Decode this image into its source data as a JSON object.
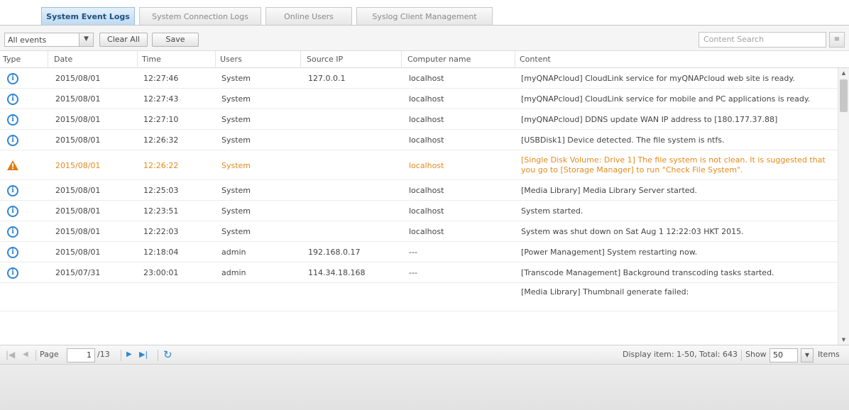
{
  "tabs": [
    {
      "label": "System Event Logs",
      "active": true
    },
    {
      "label": "System Connection Logs",
      "active": false
    },
    {
      "label": "Online Users",
      "active": false
    },
    {
      "label": "Syslog Client Management",
      "active": false
    }
  ],
  "toolbar": {
    "filter_value": "All events",
    "clear_all_label": "Clear All",
    "save_label": "Save",
    "search_placeholder": "Content Search"
  },
  "columns": [
    "Type",
    "Date",
    "Time",
    "Users",
    "Source IP",
    "Computer name",
    "Content"
  ],
  "rows": [
    {
      "type": "info",
      "date": "2015/08/01",
      "time": "12:27:46",
      "user": "System",
      "ip": "127.0.0.1",
      "computer": "localhost",
      "content": "[myQNAPcloud] CloudLink service for myQNAPcloud web site is ready."
    },
    {
      "type": "info",
      "date": "2015/08/01",
      "time": "12:27:43",
      "user": "System",
      "ip": "",
      "computer": "localhost",
      "content": "[myQNAPcloud] CloudLink service for mobile and PC applications is ready."
    },
    {
      "type": "info",
      "date": "2015/08/01",
      "time": "12:27:10",
      "user": "System",
      "ip": "",
      "computer": "localhost",
      "content": "[myQNAPcloud] DDNS update WAN IP address to [180.177.37.88]"
    },
    {
      "type": "info",
      "date": "2015/08/01",
      "time": "12:26:32",
      "user": "System",
      "ip": "",
      "computer": "localhost",
      "content": "[USBDisk1] Device detected. The file system is ntfs."
    },
    {
      "type": "warning",
      "date": "2015/08/01",
      "time": "12:26:22",
      "user": "System",
      "ip": "",
      "computer": "localhost",
      "content": "[Single Disk Volume: Drive 1] The file system is not clean. It is suggested that you go to [Storage Manager] to run \"Check File System\"."
    },
    {
      "type": "info",
      "date": "2015/08/01",
      "time": "12:25:03",
      "user": "System",
      "ip": "",
      "computer": "localhost",
      "content": "[Media Library] Media Library Server started."
    },
    {
      "type": "info",
      "date": "2015/08/01",
      "time": "12:23:51",
      "user": "System",
      "ip": "",
      "computer": "localhost",
      "content": "System started."
    },
    {
      "type": "info",
      "date": "2015/08/01",
      "time": "12:22:03",
      "user": "System",
      "ip": "",
      "computer": "localhost",
      "content": "System was shut down on Sat Aug 1 12:22:03 HKT 2015."
    },
    {
      "type": "info",
      "date": "2015/08/01",
      "time": "12:18:04",
      "user": "admin",
      "ip": "192.168.0.17",
      "computer": "---",
      "content": "[Power Management] System restarting now."
    },
    {
      "type": "info",
      "date": "2015/07/31",
      "time": "23:00:01",
      "user": "admin",
      "ip": "114.34.18.168",
      "computer": "---",
      "content": "[Transcode Management] Background transcoding tasks started."
    },
    {
      "type": "none",
      "date": "",
      "time": "",
      "user": "",
      "ip": "",
      "computer": "",
      "content": "[Media Library] Thumbnail generate failed:"
    }
  ],
  "pager": {
    "page_label": "Page",
    "current_page": "1",
    "total_pages": "/13",
    "display_info": "Display item: 1-50, Total: 643",
    "show_label": "Show",
    "page_size": "50",
    "items_label": "Items"
  },
  "colors": {
    "active_tab": "#bcd9f1",
    "info_icon": "#2f86d4",
    "warning_text": "#e48a1d",
    "warning_icon": "#e07a10"
  },
  "icons": {
    "info": "info-circle-icon",
    "warning": "warning-triangle-icon",
    "refresh": "refresh-icon",
    "first": "first-page-icon",
    "prev": "prev-page-icon",
    "next": "next-page-icon",
    "last": "last-page-icon"
  }
}
